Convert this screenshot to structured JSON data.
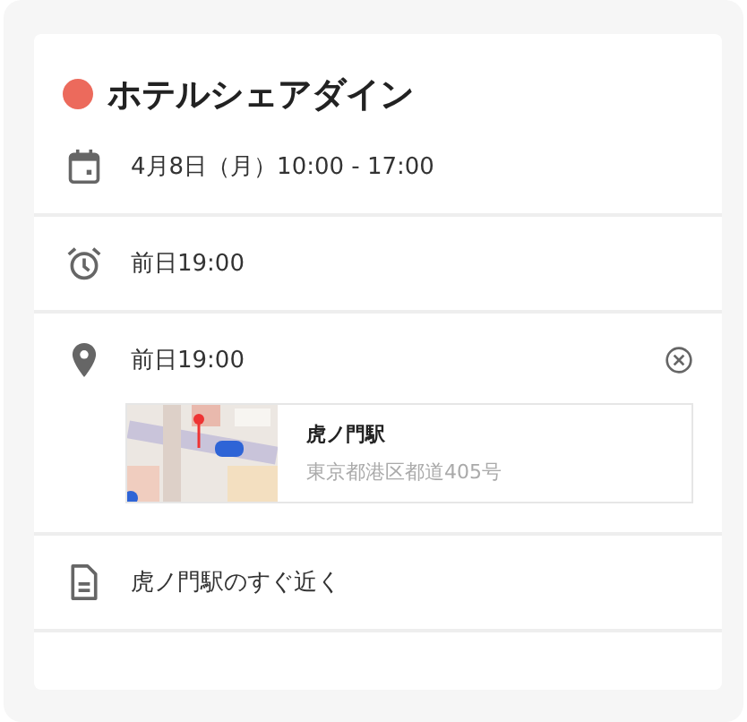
{
  "event": {
    "title": "ホテルシェアダイン",
    "color": "#ec6a5c"
  },
  "rows": [
    {
      "kind": "date",
      "text": "4月8日（月）10:00 - 17:00"
    },
    {
      "kind": "alarm",
      "text": "前日19:00"
    },
    {
      "kind": "location",
      "text": "前日19:00",
      "place": {
        "name": "虎ノ門駅",
        "address": "東京都港区都道405号"
      }
    },
    {
      "kind": "note",
      "text": "虎ノ門駅のすぐ近く"
    }
  ]
}
